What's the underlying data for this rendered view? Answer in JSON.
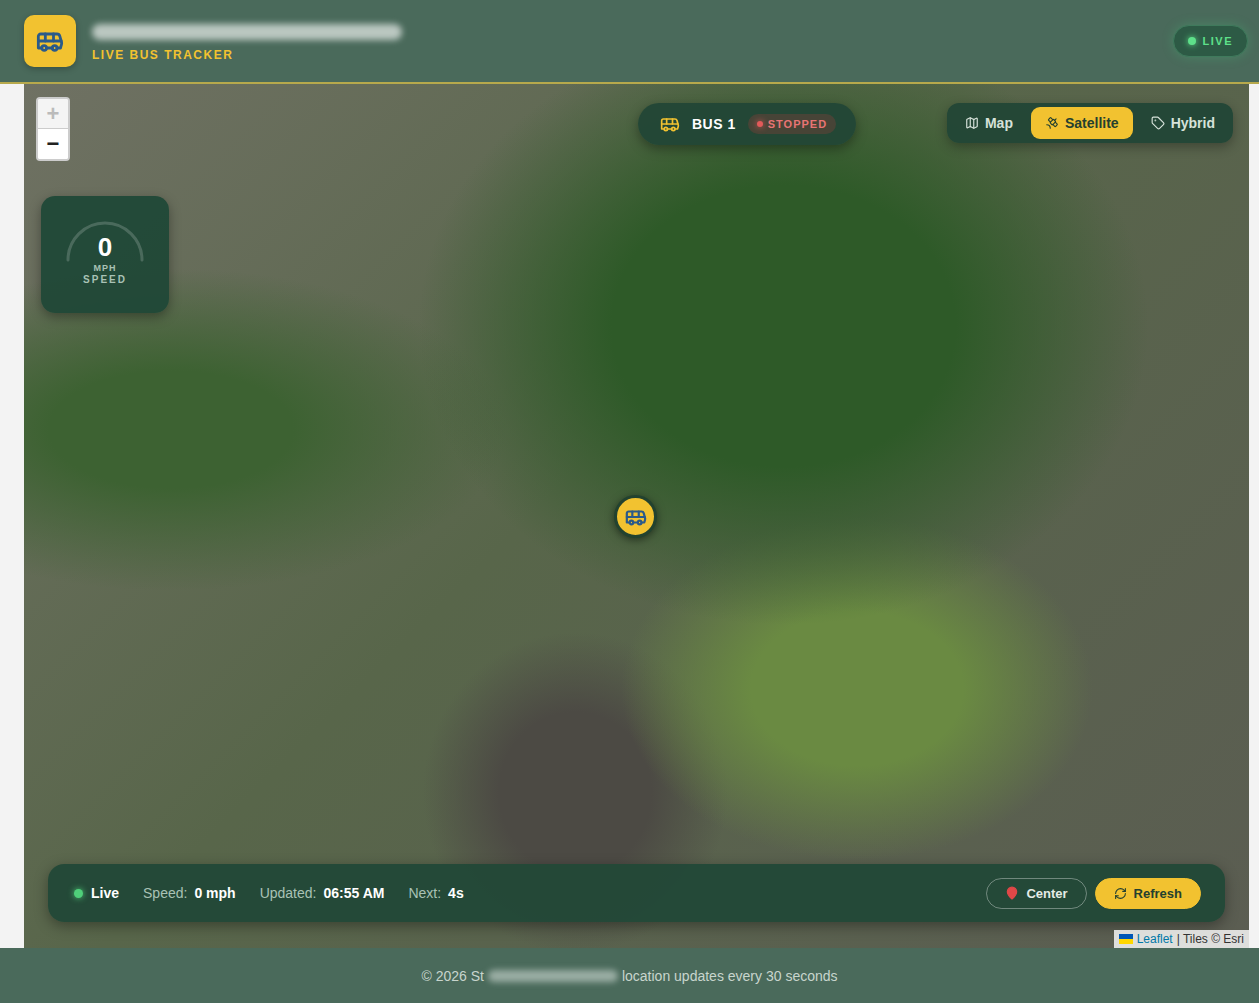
{
  "header": {
    "subtitle": "LIVE BUS TRACKER",
    "status": "LIVE"
  },
  "map": {
    "zoom": [
      {
        "label": "+",
        "disabled": true
      },
      {
        "label": "−",
        "disabled": false
      }
    ],
    "speed": {
      "value": "0",
      "unit": "MPH",
      "label": "SPEED"
    },
    "bus": {
      "name": "BUS 1",
      "status": "STOPPED"
    },
    "layers": [
      {
        "label": "Map",
        "selected": false
      },
      {
        "label": "Satellite",
        "selected": true
      },
      {
        "label": "Hybrid",
        "selected": false
      }
    ],
    "attribution": {
      "link": "Leaflet",
      "text": "| Tiles © Esri"
    }
  },
  "status_bar": {
    "live": "Live",
    "fields": [
      {
        "label": "Speed:",
        "value": "0 mph"
      },
      {
        "label": "Updated:",
        "value": "06:55 AM"
      },
      {
        "label": "Next:",
        "value": "4s"
      }
    ],
    "buttons": [
      {
        "label": "Center",
        "kind": "outline"
      },
      {
        "label": "Refresh",
        "kind": "primary"
      }
    ]
  },
  "footer": {
    "left": "© 2026 St",
    "right": "location updates every 30 seconds"
  }
}
